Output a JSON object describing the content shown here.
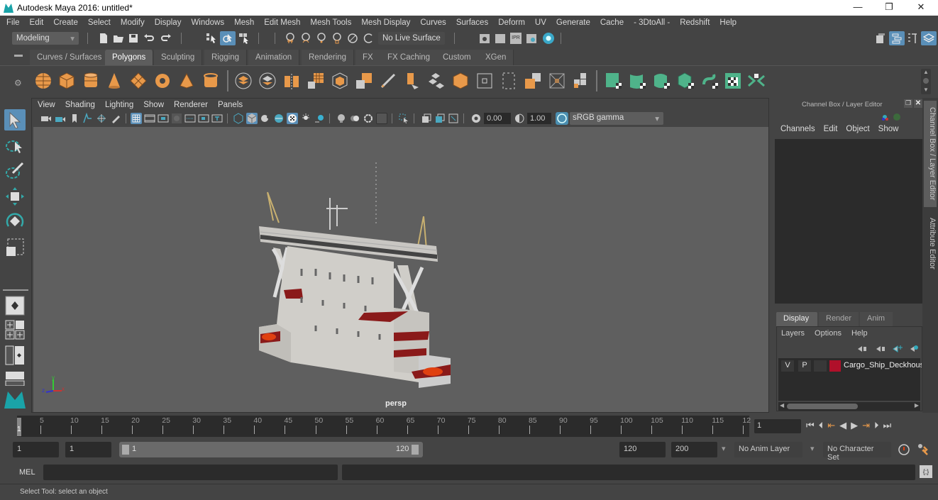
{
  "window": {
    "title": "Autodesk Maya 2016: untitled*",
    "minimize": "—",
    "maximize": "❐",
    "close": "✕"
  },
  "menubar": [
    "File",
    "Edit",
    "Create",
    "Select",
    "Modify",
    "Display",
    "Windows",
    "Mesh",
    "Edit Mesh",
    "Mesh Tools",
    "Mesh Display",
    "Curves",
    "Surfaces",
    "Deform",
    "UV",
    "Generate",
    "Cache",
    "- 3DtoAll -",
    "Redshift",
    "Help"
  ],
  "statusline": {
    "menu_set": "Modeling",
    "live_surface": "No Live Surface",
    "ipr_label": "IPR"
  },
  "shelf": {
    "tabs": [
      "Curves / Surfaces",
      "Polygons",
      "Sculpting",
      "Rigging",
      "Animation",
      "Rendering",
      "FX",
      "FX Caching",
      "Custom",
      "XGen"
    ],
    "active_tab": "Polygons",
    "colors": {
      "poly_orange": "#e8994a",
      "uv_green": "#4fb38a"
    }
  },
  "viewport": {
    "menus": [
      "View",
      "Shading",
      "Lighting",
      "Show",
      "Renderer",
      "Panels"
    ],
    "exposure": "0.00",
    "gamma": "1.00",
    "color_space": "sRGB gamma",
    "camera_label": "persp",
    "axis": {
      "x": "x",
      "y": "y",
      "z": "z"
    }
  },
  "channel_box": {
    "title": "Channel Box / Layer Editor",
    "menus": [
      "Channels",
      "Edit",
      "Object",
      "Show"
    ],
    "layer_tabs": [
      "Display",
      "Render",
      "Anim"
    ],
    "active_layer_tab": "Display",
    "layer_menus": [
      "Layers",
      "Options",
      "Help"
    ],
    "layers": [
      {
        "visible": "V",
        "playback": "P",
        "color": "#b0102a",
        "name": "Cargo_Ship_Deckhous"
      }
    ]
  },
  "side_tabs": [
    "Channel Box / Layer Editor",
    "Attribute Editor"
  ],
  "timeline": {
    "ticks": [
      "5",
      "10",
      "15",
      "20",
      "25",
      "30",
      "35",
      "40",
      "45",
      "50",
      "55",
      "60",
      "65",
      "70",
      "75",
      "80",
      "85",
      "90",
      "95",
      "100",
      "105",
      "110",
      "115",
      "12"
    ],
    "current_frame_marker": "1",
    "current_frame": "1"
  },
  "range": {
    "start": "1",
    "playback_start": "1",
    "slider_start": "1",
    "slider_end": "120",
    "playback_end": "120",
    "end": "200",
    "anim_layer": "No Anim Layer",
    "character_set": "No Character Set"
  },
  "cmdline": {
    "label": "MEL"
  },
  "helpline": {
    "text": "Select Tool: select an object"
  }
}
